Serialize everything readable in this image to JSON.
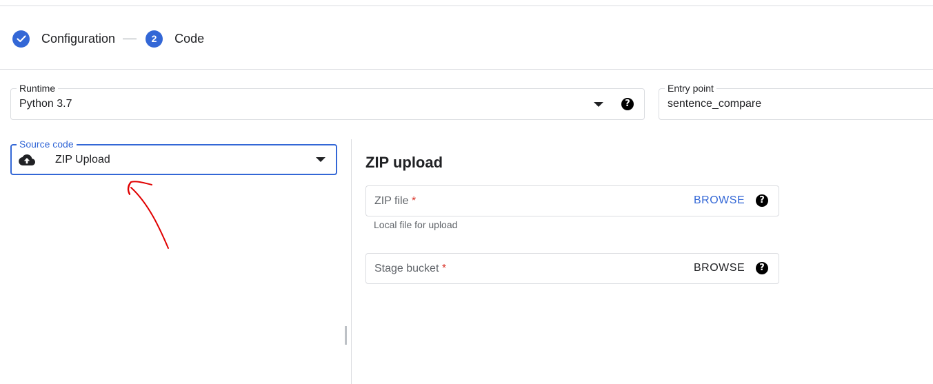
{
  "stepper": {
    "steps": [
      {
        "label": "Configuration",
        "state": "completed",
        "icon": "check-icon"
      },
      {
        "label": "Code",
        "number": "2",
        "state": "active"
      }
    ]
  },
  "runtime": {
    "label": "Runtime",
    "value": "Python 3.7"
  },
  "entry_point": {
    "label": "Entry point",
    "value": "sentence_compare"
  },
  "source_code": {
    "label": "Source code",
    "value": "ZIP Upload",
    "icon": "cloud-upload-icon"
  },
  "zip_upload": {
    "title": "ZIP upload",
    "zip_file": {
      "placeholder": "ZIP file",
      "required_mark": "*",
      "browse_label": "BROWSE",
      "hint": "Local file for upload"
    },
    "stage_bucket": {
      "placeholder": "Stage bucket",
      "required_mark": "*",
      "browse_label": "BROWSE"
    }
  },
  "colors": {
    "accent": "#3367d6",
    "required": "#d93025",
    "annotation": "#e00000"
  }
}
